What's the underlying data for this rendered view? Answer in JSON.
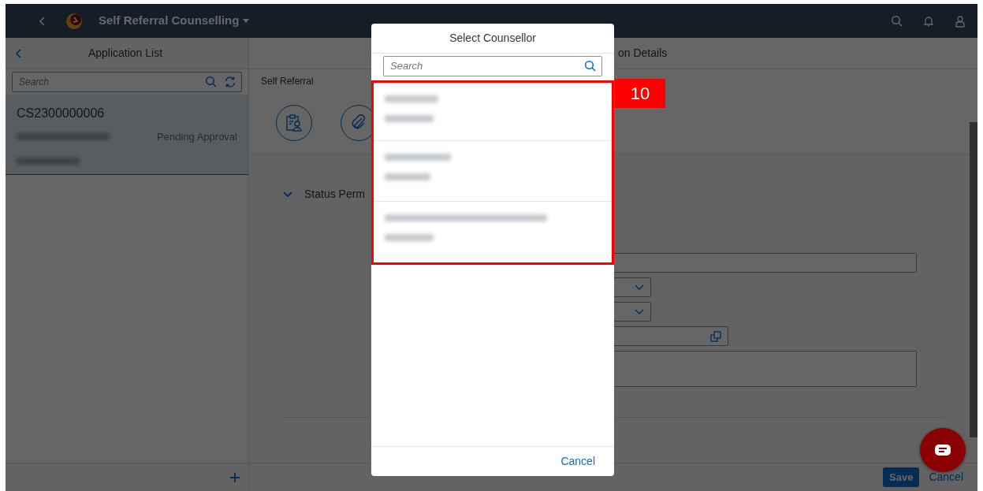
{
  "shell": {
    "title": "Self Referral Counselling"
  },
  "master": {
    "title": "Application List",
    "search": {
      "placeholder": "Search"
    },
    "items": [
      {
        "id": "CS2300000006",
        "status": "Pending Approval",
        "selected": true
      }
    ]
  },
  "detail": {
    "title": "on Details",
    "breadcrumb": "Self Referral",
    "section": {
      "label": "Status Perm",
      "expanded": true
    },
    "footer": {
      "buttons": [
        {
          "label": "Save",
          "kind": "primary"
        },
        {
          "label": "Cancel",
          "kind": "plain"
        }
      ]
    }
  },
  "dialog": {
    "title": "Select Counsellor",
    "search": {
      "placeholder": "Search"
    },
    "items": [
      {
        "kind": "redacted"
      },
      {
        "kind": "redacted"
      },
      {
        "kind": "redacted"
      }
    ],
    "cancel": "Cancel"
  },
  "annotation": {
    "label": "10"
  }
}
